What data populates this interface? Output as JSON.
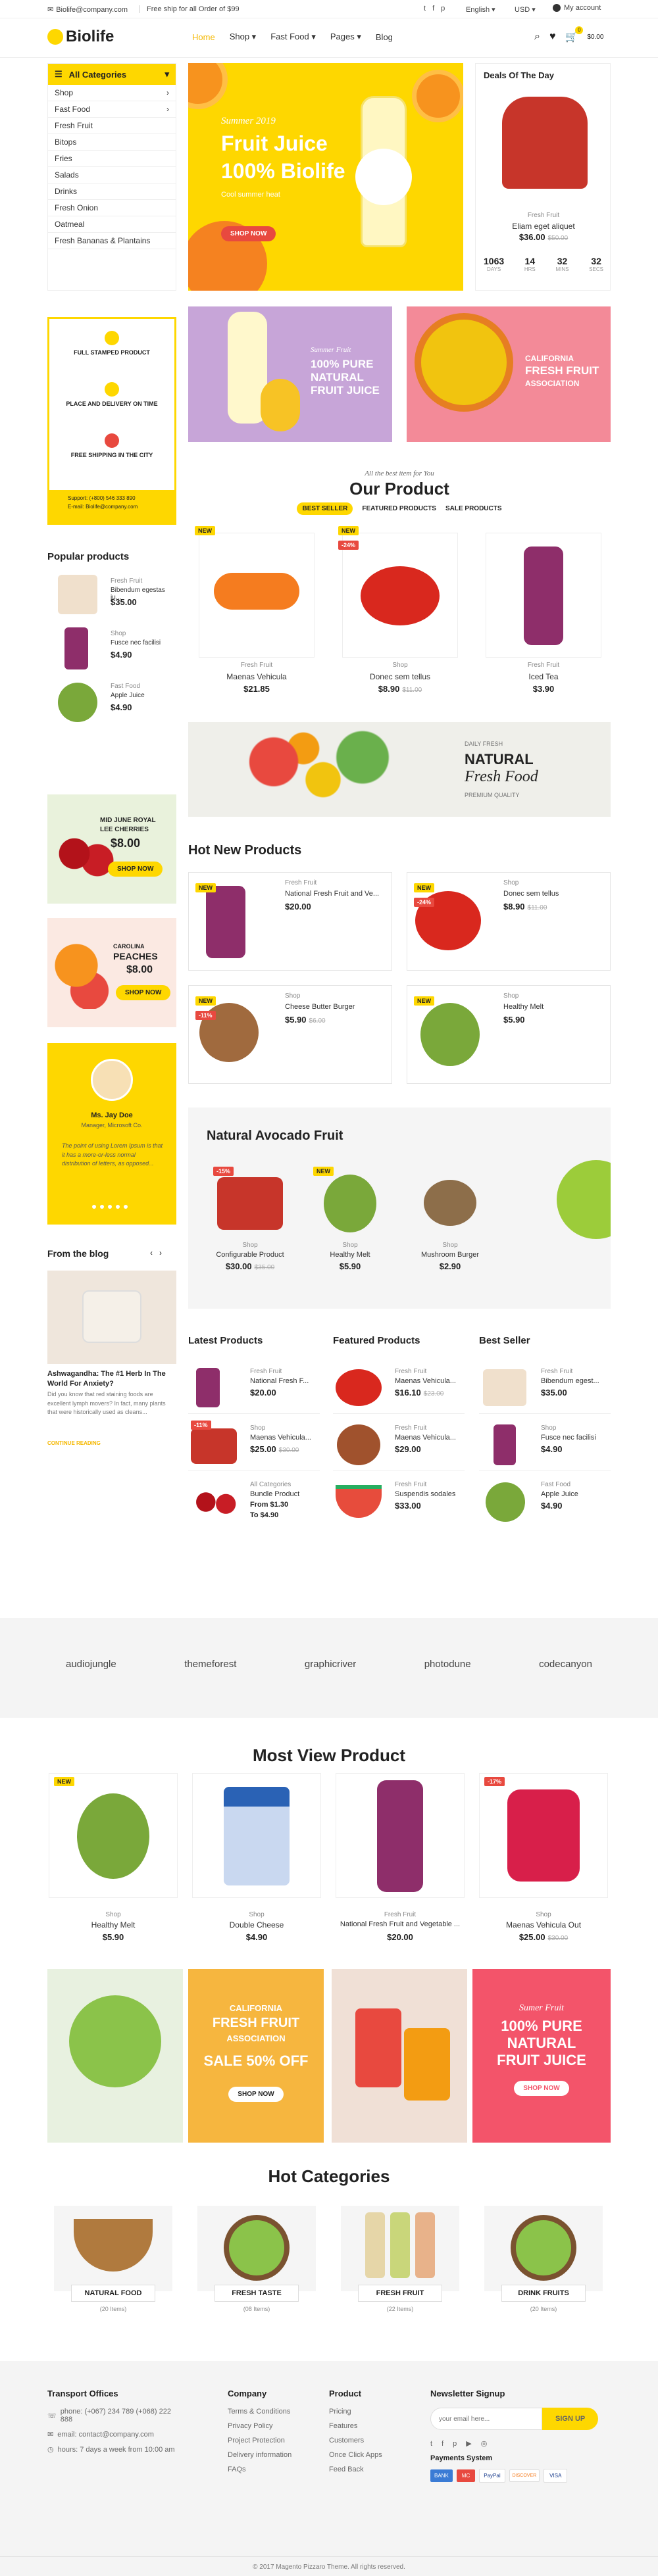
{
  "topbar": {
    "email": "Biolife@company.com",
    "shipping": "Free ship for all Order of $99",
    "language": "English",
    "currency": "USD",
    "account": "My account"
  },
  "header": {
    "logo": "Biolife",
    "nav": [
      "Home",
      "Shop",
      "Fast Food",
      "Pages",
      "Blog"
    ],
    "cart_count": "0",
    "cart_total": "$0.00"
  },
  "categories": {
    "title": "All Categories",
    "items": [
      "Shop",
      "Fast Food",
      "Fresh Fruit",
      "Bitops",
      "Fries",
      "Salads",
      "Drinks",
      "Fresh Onion",
      "Oatmeal",
      "Fresh Bananas & Plantains"
    ]
  },
  "hero": {
    "line1": "Summer 2019",
    "line2": "Fruit Juice",
    "line3": "100% Biolife",
    "sub": "Cool summer heat",
    "btn": "SHOP NOW"
  },
  "deal": {
    "title": "Deals Of The Day",
    "cat": "Fresh Fruit",
    "name": "Eliam eget aliquet",
    "price": "$36.00",
    "old": "$50.00",
    "countdown": [
      {
        "v": "1063",
        "u": "DAYS"
      },
      {
        "v": "14",
        "u": "HRS"
      },
      {
        "v": "32",
        "u": "MINS"
      },
      {
        "v": "32",
        "u": "SECS"
      }
    ]
  },
  "services": [
    {
      "label": "FULL STAMPED PRODUCT"
    },
    {
      "label": "PLACE AND DELIVERY ON TIME"
    },
    {
      "label": "FREE SHIPPING IN THE CITY"
    }
  ],
  "support": {
    "line1": "Support: (+800) 546 333 890",
    "line2": "E-mail: Biolife@company.com"
  },
  "banners": {
    "b1": {
      "sm": "Summer Fruit",
      "l1": "100% PURE",
      "l2": "NATURAL",
      "l3": "FRUIT JUICE"
    },
    "b2": {
      "l1": "CALIFORNIA",
      "l2": "FRESH FRUIT",
      "l3": "ASSOCIATION"
    }
  },
  "our_product": {
    "sub": "All the best item for You",
    "title": "Our Product",
    "tabs": [
      "BEST SELLER",
      "FEATURED PRODUCTS",
      "SALE PRODUCTS"
    ],
    "items": [
      {
        "tag": "NEW",
        "cat": "Fresh Fruit",
        "name": "Maenas Vehicula",
        "price": "$21.85",
        "old": ""
      },
      {
        "tag": "NEW",
        "tag2": "-24%",
        "cat": "Shop",
        "name": "Donec sem tellus",
        "price": "$8.90",
        "old": "$11.00"
      },
      {
        "tag": "",
        "cat": "Fresh Fruit",
        "name": "Iced Tea",
        "price": "$3.90",
        "old": ""
      }
    ]
  },
  "popular": {
    "title": "Popular products",
    "items": [
      {
        "cat": "Fresh Fruit",
        "name": "Bibendum egestas ju...",
        "price": "$35.00"
      },
      {
        "cat": "Shop",
        "name": "Fusce nec facilisi",
        "price": "$4.90"
      },
      {
        "cat": "Fast Food",
        "name": "Apple Juice",
        "price": "$4.90"
      }
    ]
  },
  "natural_banner": {
    "l1": "DAILY FRESH",
    "l2": "NATURAL",
    "l3": "Fresh Food",
    "l4": "PREMIUM QUALITY"
  },
  "cherries": {
    "l1": "MID JUNE ROYAL",
    "l2": "LEE CHERRIES",
    "l3": "$8.00",
    "btn": "SHOP NOW"
  },
  "peaches": {
    "l1": "CAROLINA",
    "l2": "PEACHES",
    "l3": "$8.00",
    "btn": "SHOP NOW"
  },
  "hot_new": {
    "title": "Hot New Products",
    "items": [
      {
        "tag": "NEW",
        "cat": "Fresh Fruit",
        "name": "National Fresh Fruit and Ve...",
        "price": "$20.00",
        "old": ""
      },
      {
        "tag": "NEW",
        "tag2": "-24%",
        "cat": "Shop",
        "name": "Donec sem tellus",
        "price": "$8.90",
        "old": "$11.00"
      },
      {
        "tag": "NEW",
        "tag2": "-11%",
        "cat": "Shop",
        "name": "Cheese Butter Burger",
        "price": "$5.90",
        "old": "$6.00"
      },
      {
        "tag": "NEW",
        "cat": "Shop",
        "name": "Healthy Melt",
        "price": "$5.90",
        "old": ""
      }
    ]
  },
  "testimonial": {
    "name": "Ms. Jay Doe",
    "role": "Manager, Microsoft Co.",
    "quote": "The point of using Lorem Ipsum is that it has a more-or-less normal distribution of letters, as opposed..."
  },
  "avocado": {
    "title": "Natural Avocado Fruit",
    "items": [
      {
        "tag": "-15%",
        "cat": "Shop",
        "name": "Configurable Product",
        "price": "$30.00",
        "old": "$35.00"
      },
      {
        "tag": "NEW",
        "cat": "Shop",
        "name": "Healthy Melt",
        "price": "$5.90",
        "old": ""
      },
      {
        "tag": "",
        "cat": "Shop",
        "name": "Mushroom Burger",
        "price": "$2.90",
        "old": ""
      }
    ]
  },
  "blog": {
    "title": "From the blog",
    "post_title": "Ashwagandha: The #1 Herb In The World For Anxiety?",
    "excerpt": "Did you know that red staining foods are excellent lymph movers? In fact, many plants that were historically used as cleans...",
    "more": "CONTINUE READING"
  },
  "lists": [
    {
      "title": "Latest Products",
      "items": [
        {
          "cat": "Fresh Fruit",
          "name": "National Fresh F...",
          "price": "$20.00",
          "old": ""
        },
        {
          "tag": "-11%",
          "cat": "Shop",
          "name": "Maenas Vehicula...",
          "price": "$25.00",
          "old": "$30.00"
        },
        {
          "cat": "All Categories",
          "name": "Bundle Product",
          "price": "From $1.30",
          "price2": "To $4.90"
        }
      ]
    },
    {
      "title": "Featured Products",
      "items": [
        {
          "cat": "Fresh Fruit",
          "name": "Maenas Vehicula...",
          "price": "$16.10",
          "old": "$23.00"
        },
        {
          "cat": "Fresh Fruit",
          "name": "Maenas Vehicula...",
          "price": "$29.00",
          "old": ""
        },
        {
          "cat": "Fresh Fruit",
          "name": "Suspendis sodales",
          "price": "$33.00",
          "old": ""
        }
      ]
    },
    {
      "title": "Best Seller",
      "items": [
        {
          "cat": "Fresh Fruit",
          "name": "Bibendum egest...",
          "price": "$35.00",
          "old": ""
        },
        {
          "cat": "Shop",
          "name": "Fusce nec facilisi",
          "price": "$4.90",
          "old": ""
        },
        {
          "cat": "Fast Food",
          "name": "Apple Juice",
          "price": "$4.90",
          "old": ""
        }
      ]
    }
  ],
  "brands": [
    "audiojungle",
    "themeforest",
    "graphicriver",
    "photodune",
    "codecanyon"
  ],
  "most_view": {
    "title": "Most View Product",
    "items": [
      {
        "tag": "NEW",
        "cat": "Shop",
        "name": "Healthy Melt",
        "price": "$5.90",
        "old": ""
      },
      {
        "tag": "",
        "cat": "Shop",
        "name": "Double Cheese",
        "price": "$4.90",
        "old": ""
      },
      {
        "tag": "",
        "cat": "Fresh Fruit",
        "name": "National Fresh Fruit and Vegetable ...",
        "price": "$20.00",
        "old": ""
      },
      {
        "tag": "-17%",
        "cat": "Shop",
        "name": "Maenas Vehicula Out",
        "price": "$25.00",
        "old": "$30.00"
      }
    ]
  },
  "promo": {
    "p1": {
      "l1": "CALIFORNIA",
      "l2": "FRESH FRUIT",
      "l3": "ASSOCIATION",
      "l4": "SALE 50% OFF",
      "btn": "SHOP NOW"
    },
    "p2": {
      "sm": "Sumer Fruit",
      "l1": "100% PURE",
      "l2": "NATURAL",
      "l3": "FRUIT JUICE",
      "btn": "SHOP NOW"
    }
  },
  "hot_cat": {
    "title": "Hot Categories",
    "items": [
      {
        "name": "NATURAL FOOD",
        "count": "(20 Items)"
      },
      {
        "name": "FRESH TASTE",
        "count": "(08 Items)"
      },
      {
        "name": "FRESH FRUIT",
        "count": "(22 Items)"
      },
      {
        "name": "DRINK FRUITS",
        "count": "(20 Items)"
      }
    ]
  },
  "footer": {
    "transport_title": "Transport Offices",
    "phone": "phone: (+067) 234 789 (+068) 222 888",
    "email": "email: contact@company.com",
    "hours": "hours: 7 days a week from 10:00 am",
    "company_title": "Company",
    "company_links": [
      "Terms & Conditions",
      "Privacy Policy",
      "Project Protection",
      "Delivery information",
      "FAQs"
    ],
    "product_title": "Product",
    "product_links": [
      "Pricing",
      "Features",
      "Customers",
      "Once Click Apps",
      "Feed Back"
    ],
    "newsletter_title": "Newsletter Signup",
    "newsletter_placeholder": "your email here...",
    "signup": "SIGN UP",
    "payments_title": "Payments System",
    "payments": [
      "BANK",
      "MC",
      "PayPal",
      "DISCOVER",
      "VISA"
    ],
    "copyright": "© 2017 Magento Pizzaro Theme. All rights reserved."
  }
}
